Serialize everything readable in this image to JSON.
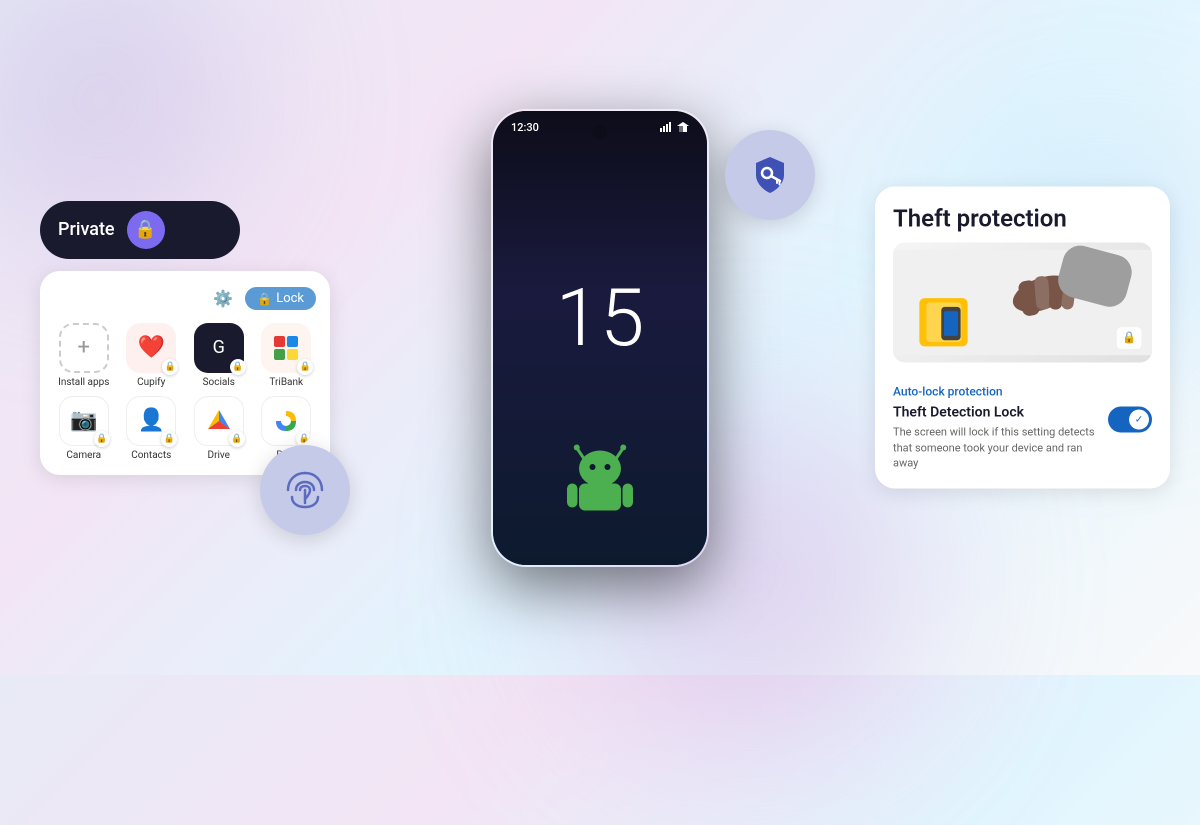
{
  "background": {
    "gradient": "linear-gradient(135deg, #e8eaf6 0%, #f3e5f5 30%, #e1f5fe 60%, #f8f9fa 100%)"
  },
  "phone": {
    "time": "12:30",
    "clock_number": "15"
  },
  "private_panel": {
    "private_label": "Private",
    "lock_btn_label": "Lock",
    "apps": [
      {
        "name": "Install apps",
        "icon": "+",
        "type": "install"
      },
      {
        "name": "Cupify",
        "icon": "❤️",
        "type": "cupify"
      },
      {
        "name": "Socials",
        "icon": "◎",
        "type": "socials"
      },
      {
        "name": "TriBank",
        "icon": "🏦",
        "type": "tribank"
      },
      {
        "name": "Camera",
        "icon": "📷",
        "type": "camera"
      },
      {
        "name": "Contacts",
        "icon": "👤",
        "type": "contacts"
      },
      {
        "name": "Drive",
        "icon": "▲",
        "type": "drive"
      },
      {
        "name": "Photos",
        "icon": "🌸",
        "type": "photos"
      }
    ]
  },
  "theft_card": {
    "title": "Theft protection",
    "auto_lock_label": "Auto-lock protection",
    "detection_title": "Theft Detection Lock",
    "detection_desc": "The screen will lock if this setting detects that someone took your device and ran away",
    "toggle_enabled": true
  },
  "icons": {
    "fingerprint": "◉",
    "security_key": "🔑",
    "lock": "🔒",
    "gear": "⚙️",
    "check": "✓"
  }
}
